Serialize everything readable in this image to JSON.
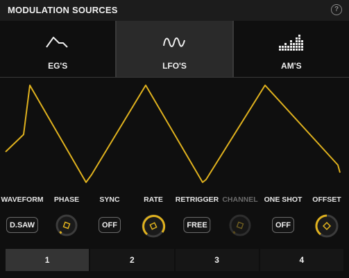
{
  "header": {
    "title": "MODULATION SOURCES",
    "help_icon": "?"
  },
  "tabs": [
    {
      "label": "EG'S",
      "icon": "envelope-icon",
      "active": false
    },
    {
      "label": "LFO'S",
      "icon": "sine-wave-icon",
      "active": true
    },
    {
      "label": "AM'S",
      "icon": "step-bars-icon",
      "active": false
    }
  ],
  "waveform_display": {
    "shape": "descending sawtooth",
    "color": "#e0b21e"
  },
  "params": {
    "waveform": {
      "label": "WAVEFORM",
      "value": "D.SAW"
    },
    "phase": {
      "label": "PHASE",
      "level": 0.05
    },
    "sync": {
      "label": "SYNC",
      "value": "OFF"
    },
    "rate": {
      "label": "RATE",
      "level": 0.75
    },
    "retrigger": {
      "label": "RETRIGGER",
      "value": "FREE"
    },
    "channel": {
      "label": "CHANNEL",
      "enabled": false
    },
    "one_shot": {
      "label": "ONE SHOT",
      "value": "OFF"
    },
    "offset": {
      "label": "OFFSET",
      "level": 0.5
    }
  },
  "pages": [
    {
      "label": "1",
      "active": true
    },
    {
      "label": "2",
      "active": false
    },
    {
      "label": "3",
      "active": false
    },
    {
      "label": "4",
      "active": false
    }
  ],
  "colors": {
    "accent": "#e0b21e",
    "background": "#0f0f0f",
    "panel": "#1c1c1c",
    "active_tab": "#2a2a2a"
  }
}
